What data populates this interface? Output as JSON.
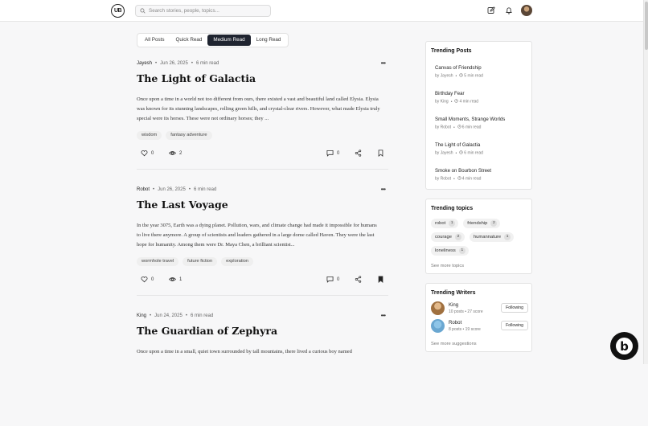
{
  "header": {
    "logo": "UB",
    "search_placeholder": "Search stories, people, topics..."
  },
  "filters": [
    "All Posts",
    "Quick Read",
    "Medium Read",
    "Long Read"
  ],
  "active_filter": "Medium Read",
  "posts": [
    {
      "author": "Jayesh",
      "date": "Jun 26, 2025",
      "read_time": "6 min read",
      "title": "The Light of Galactia",
      "excerpt": "Once upon a time in a world not too different from ours, there existed a vast and beautiful land called Elysia. Elysia was known for its stunning landscapes, rolling green hills, and crystal-clear rivers. However, what made Elysia truly special were its horses. These were not ordinary horses; they ...",
      "tags": [
        "wisdom",
        "fantasy adventure"
      ],
      "likes": "0",
      "views": "2",
      "comments": "0",
      "bookmarked": false
    },
    {
      "author": "Robot",
      "date": "Jun 26, 2025",
      "read_time": "6 min read",
      "title": "The Last Voyage",
      "excerpt": "In the year 3075, Earth was a dying planet. Pollution, wars, and climate change had made it impossible for humans to live there anymore. A group of scientists and leaders gathered in a large dome called Haven. They were the last hope for humanity. Among them were Dr. Maya Chen, a brilliant scientist...",
      "tags": [
        "wormhole travel",
        "future fiction",
        "exploration"
      ],
      "likes": "0",
      "views": "1",
      "comments": "0",
      "bookmarked": true
    },
    {
      "author": "King",
      "date": "Jun 24, 2025",
      "read_time": "6 min read",
      "title": "The Guardian of Zephyra",
      "excerpt": "Once upon a time in a small, quiet town surrounded by tall mountains, there lived a curious boy named",
      "tags": [],
      "likes": "",
      "views": "",
      "comments": "",
      "bookmarked": false
    }
  ],
  "trending_posts": {
    "title": "Trending Posts",
    "items": [
      {
        "title": "Canvas of Friendship",
        "by": "by Jayesh",
        "time": "5 min read"
      },
      {
        "title": "Birthday Fear",
        "by": "by King",
        "time": "4 min read"
      },
      {
        "title": "Small Moments, Strange Worlds",
        "by": "by Robot",
        "time": "6 min read"
      },
      {
        "title": "The Light of Galactia",
        "by": "by Jayesh",
        "time": "6 min read"
      },
      {
        "title": "Smoke on Bourbon Street",
        "by": "by Robot",
        "time": "4 min read"
      }
    ]
  },
  "trending_topics": {
    "title": "Trending topics",
    "items": [
      {
        "name": "robot",
        "count": "1"
      },
      {
        "name": "friendship",
        "count": "2"
      },
      {
        "name": "courage",
        "count": "2"
      },
      {
        "name": "humannature",
        "count": "1"
      },
      {
        "name": "loneliness",
        "count": "1"
      }
    ],
    "see_more": "See more topics"
  },
  "trending_writers": {
    "title": "Trending Writers",
    "items": [
      {
        "name": "King",
        "stats": "10 posts  •  27 score",
        "button": "Following"
      },
      {
        "name": "Robot",
        "stats": "8 posts  •  19 score",
        "button": "Following"
      }
    ],
    "see_more": "See more suggestions"
  },
  "badge": "b"
}
